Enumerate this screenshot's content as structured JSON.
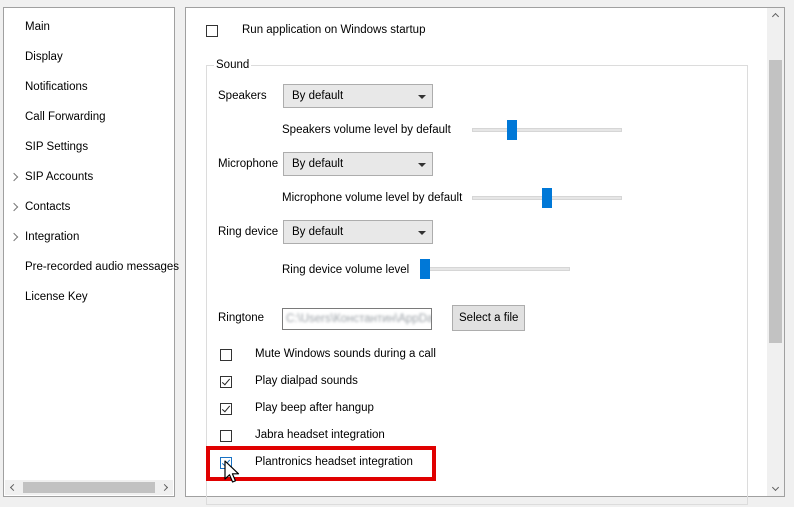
{
  "nav": {
    "items": [
      {
        "label": "Main",
        "expandable": false
      },
      {
        "label": "Display",
        "expandable": false
      },
      {
        "label": "Notifications",
        "expandable": false
      },
      {
        "label": "Call Forwarding",
        "expandable": false
      },
      {
        "label": "SIP Settings",
        "expandable": false
      },
      {
        "label": "SIP Accounts",
        "expandable": true
      },
      {
        "label": "Contacts",
        "expandable": true
      },
      {
        "label": "Integration",
        "expandable": true
      },
      {
        "label": "Pre-recorded audio messages",
        "expandable": false
      },
      {
        "label": "License Key",
        "expandable": false
      }
    ]
  },
  "main": {
    "startup": {
      "label": "Run application on Windows startup",
      "checked": false
    },
    "sound": {
      "title": "Sound",
      "speakers": {
        "label": "Speakers",
        "value": "By default"
      },
      "speakers_volume": {
        "label": "Speakers volume level by default",
        "level": 0.25
      },
      "microphone": {
        "label": "Microphone",
        "value": "By default"
      },
      "microphone_volume": {
        "label": "Microphone volume level by default",
        "level": 0.5
      },
      "ring_device": {
        "label": "Ring device",
        "value": "By default"
      },
      "ring_volume": {
        "label": "Ring device volume level",
        "level": 0.0
      },
      "ringtone": {
        "label": "Ringtone",
        "value": "C:\\Users\\Константин\\AppData",
        "button": "Select a file"
      },
      "options": [
        {
          "label": "Mute Windows sounds during a call",
          "checked": false
        },
        {
          "label": "Play dialpad sounds",
          "checked": true
        },
        {
          "label": "Play beep after hangup",
          "checked": true
        },
        {
          "label": "Jabra headset integration",
          "checked": false
        },
        {
          "label": "Plantronics headset integration",
          "checked": true
        }
      ]
    }
  },
  "colors": {
    "accent": "#0078d7",
    "highlight": "#e00000"
  }
}
